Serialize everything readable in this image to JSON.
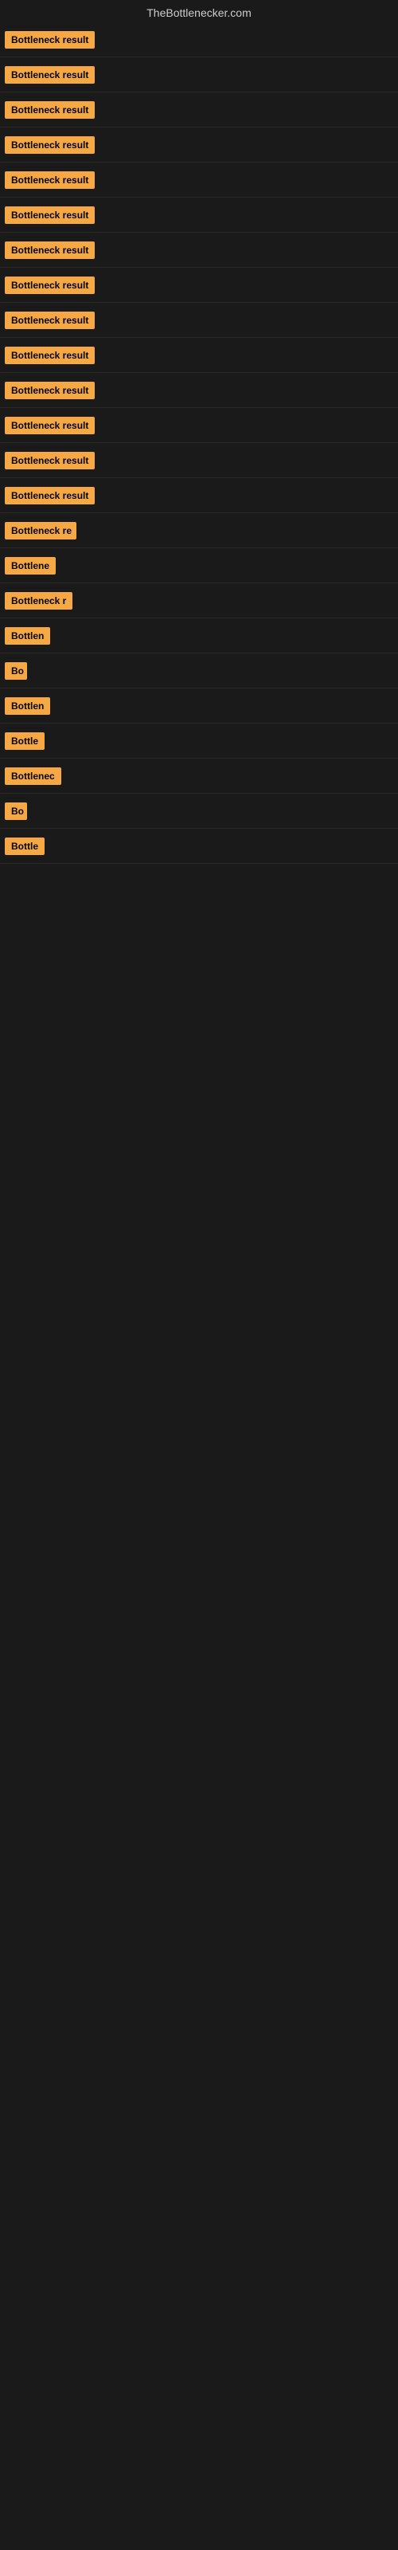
{
  "site": {
    "title": "TheBottlenecker.com"
  },
  "rows": [
    {
      "id": 1,
      "label": "Bottleneck result",
      "width": 120,
      "visible_text": "Bottleneck result"
    },
    {
      "id": 2,
      "label": "Bottleneck result",
      "width": 120,
      "visible_text": "Bottleneck result"
    },
    {
      "id": 3,
      "label": "Bottleneck result",
      "width": 120,
      "visible_text": "Bottleneck result"
    },
    {
      "id": 4,
      "label": "Bottleneck result",
      "width": 120,
      "visible_text": "Bottleneck result"
    },
    {
      "id": 5,
      "label": "Bottleneck result",
      "width": 120,
      "visible_text": "Bottleneck result"
    },
    {
      "id": 6,
      "label": "Bottleneck result",
      "width": 120,
      "visible_text": "Bottleneck result"
    },
    {
      "id": 7,
      "label": "Bottleneck result",
      "width": 120,
      "visible_text": "Bottleneck result"
    },
    {
      "id": 8,
      "label": "Bottleneck result",
      "width": 120,
      "visible_text": "Bottleneck result"
    },
    {
      "id": 9,
      "label": "Bottleneck result",
      "width": 120,
      "visible_text": "Bottleneck result"
    },
    {
      "id": 10,
      "label": "Bottleneck result",
      "width": 120,
      "visible_text": "Bottleneck result"
    },
    {
      "id": 11,
      "label": "Bottleneck result",
      "width": 120,
      "visible_text": "Bottleneck result"
    },
    {
      "id": 12,
      "label": "Bottleneck result",
      "width": 120,
      "visible_text": "Bottleneck result"
    },
    {
      "id": 13,
      "label": "Bottleneck result",
      "width": 120,
      "visible_text": "Bottleneck result"
    },
    {
      "id": 14,
      "label": "Bottleneck result",
      "width": 120,
      "visible_text": "Bottleneck result"
    },
    {
      "id": 15,
      "label": "Bottleneck re",
      "width": 90,
      "visible_text": "Bottleneck re"
    },
    {
      "id": 16,
      "label": "Bottlene",
      "width": 70,
      "visible_text": "Bottlene"
    },
    {
      "id": 17,
      "label": "Bottleneck r",
      "width": 85,
      "visible_text": "Bottleneck r"
    },
    {
      "id": 18,
      "label": "Bottlen",
      "width": 60,
      "visible_text": "Bottlen"
    },
    {
      "id": 19,
      "label": "Bo",
      "width": 28,
      "visible_text": "Bo"
    },
    {
      "id": 20,
      "label": "Bottlen",
      "width": 60,
      "visible_text": "Bottlen"
    },
    {
      "id": 21,
      "label": "Bottle",
      "width": 52,
      "visible_text": "Bottle"
    },
    {
      "id": 22,
      "label": "Bottlenec",
      "width": 76,
      "visible_text": "Bottlenec"
    },
    {
      "id": 23,
      "label": "Bo",
      "width": 28,
      "visible_text": "Bo"
    },
    {
      "id": 24,
      "label": "Bottle",
      "width": 52,
      "visible_text": "Bottle"
    }
  ]
}
